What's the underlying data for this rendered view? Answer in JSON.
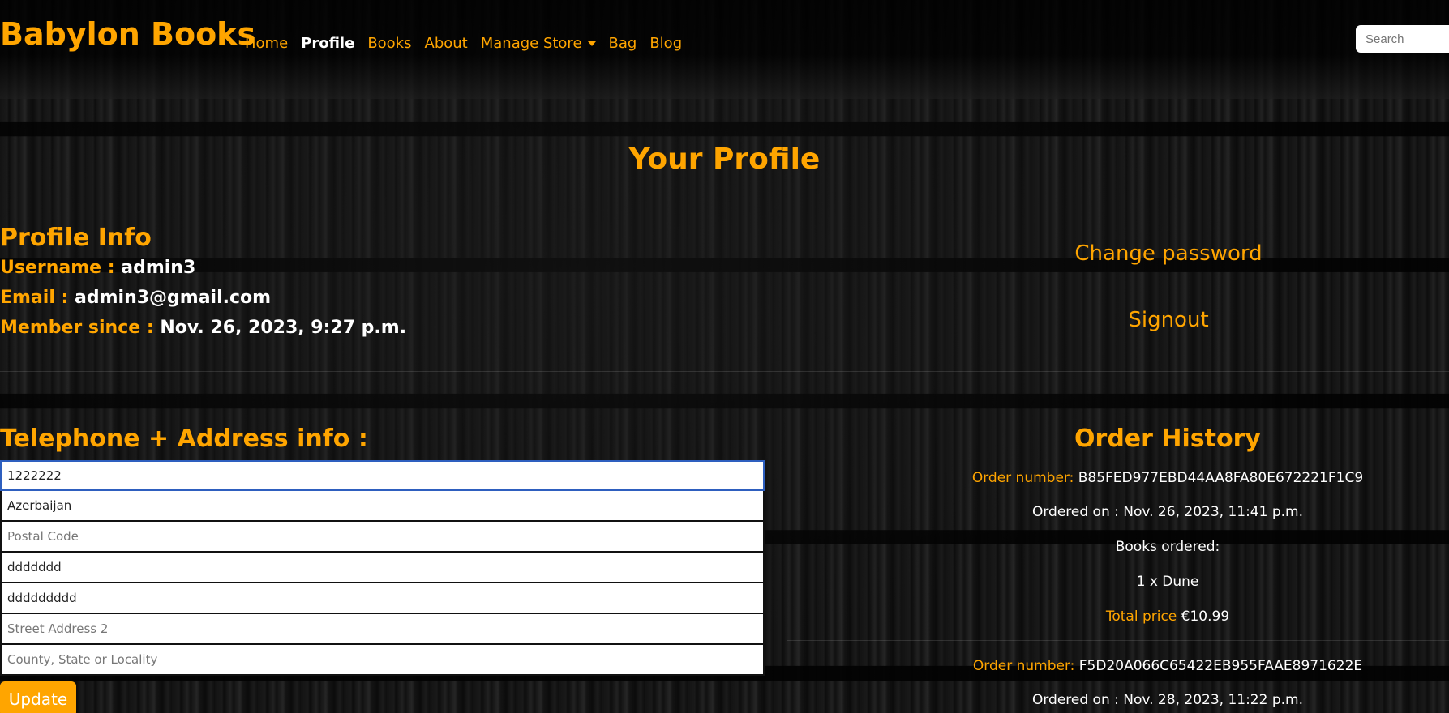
{
  "header": {
    "brand": "Babylon Books",
    "nav": [
      {
        "label": "Home"
      },
      {
        "label": "Profile"
      },
      {
        "label": "Books"
      },
      {
        "label": "About"
      },
      {
        "label": "Manage Store"
      },
      {
        "label": "Bag"
      },
      {
        "label": "Blog"
      }
    ],
    "search_placeholder": "Search"
  },
  "page_title": "Your Profile",
  "profile_info": {
    "title": "Profile Info",
    "username_label": "Username :",
    "username": "admin3",
    "email_label": "Email :",
    "email": "admin3@gmail.com",
    "member_since_label": "Member since :",
    "member_since": "Nov. 26, 2023, 9:27 p.m."
  },
  "account_links": {
    "change_password": "Change password",
    "signout": "Signout"
  },
  "address_form": {
    "title": "Telephone + Address info :",
    "phone_value": "1222222",
    "country_value": "Azerbaijan",
    "postal_placeholder": "Postal Code",
    "city_value": "ddddddd",
    "street1_value": "ddddddddd",
    "street2_placeholder": "Street Address 2",
    "county_placeholder": "County, State or Locality",
    "update_label": "Update"
  },
  "order_history": {
    "title": "Order History",
    "orders": [
      {
        "number_label": "Order number:",
        "number": "B85FED977EBD44AA8FA80E672221F1C9",
        "ordered_on": "Ordered on : Nov. 26, 2023, 11:41 p.m.",
        "books_label": "Books ordered:",
        "books": "1 x Dune",
        "total_label": "Total price",
        "total": "€10.99"
      },
      {
        "number_label": "Order number:",
        "number": "F5D20A066C65422EB955FAAE8971622E",
        "ordered_on": "Ordered on : Nov. 28, 2023, 11:22 p.m."
      }
    ]
  },
  "colors": {
    "accent": "#ffa500",
    "text": "#ffffff"
  }
}
